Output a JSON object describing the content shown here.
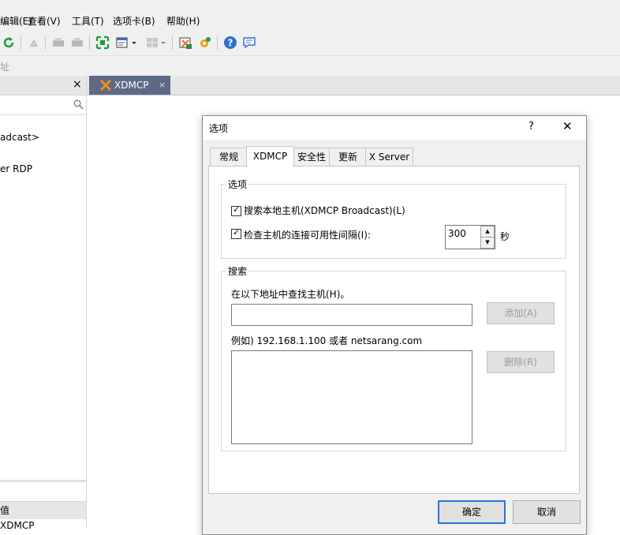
{
  "menu": {
    "edit": "编辑(E)",
    "view": "查看(V)",
    "tools": "工具(T)",
    "tab": "选项卡(B)",
    "help": "帮助(H)"
  },
  "toolbar_icons": [
    "refresh-icon",
    "disconnect-icon",
    "print-icon",
    "print-preview-icon",
    "fullscreen-icon",
    "layout-icon",
    "layout-dropdown",
    "split-icon",
    "split-dropdown",
    "xftp-icon",
    "xagent-icon",
    "help-icon",
    "chat-icon"
  ],
  "address": {
    "label": "址"
  },
  "left_panel": {
    "close": "×",
    "items": [
      "adcast>",
      "er RDP"
    ],
    "properties_label": "值",
    "properties_value": "XDMCP"
  },
  "tab": {
    "label": "XDMCP",
    "close": "×"
  },
  "dialog": {
    "title": "选项",
    "help": "?",
    "close": "✕",
    "tabs": [
      "常规",
      "XDMCP",
      "安全性",
      "更新",
      "X Server"
    ],
    "active_tab": "XDMCP",
    "options_group": {
      "title": "选项",
      "search_local": "搜索本地主机(XDMCP Broadcast)(L)",
      "search_local_checked": true,
      "check_interval": "检查主机的连接可用性间隔(I):",
      "check_interval_checked": true,
      "interval_value": "300",
      "interval_unit": "秒"
    },
    "search_group": {
      "title": "搜索",
      "find_label": "在以下地址中查找主机(H)。",
      "address_input": "",
      "add_button": "添加(A)",
      "example": "例如) 192.168.1.100 或者 netsarang.com",
      "delete_button": "删除(R)"
    },
    "ok": "确定",
    "cancel": "取消"
  }
}
